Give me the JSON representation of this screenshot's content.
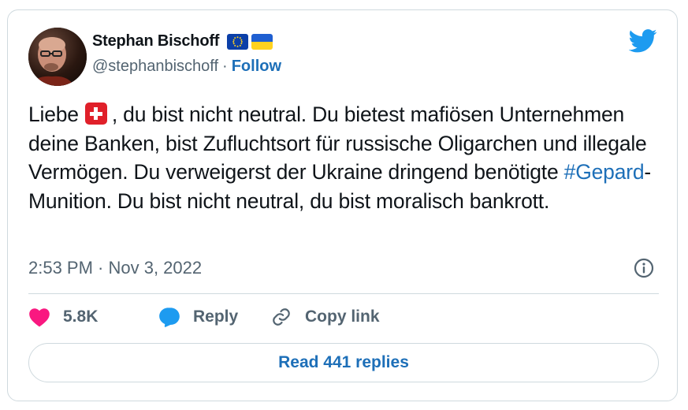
{
  "author": {
    "display_name": "Stephan Bischoff",
    "handle": "@stephanbischoff",
    "separator": "·",
    "follow_label": "Follow",
    "flags": [
      "eu-flag-icon",
      "ukraine-flag-icon"
    ]
  },
  "tweet": {
    "text_part1": "Liebe",
    "text_part2": ", du bist nicht neutral. Du bietest mafiösen Unternehmen deine Banken, bist Zufluchtsort für russische Oligarchen und illegale Vermögen. Du verweigerst der Ukraine dringend benötigte ",
    "hashtag": "#Gepard",
    "text_part3": "-Munition. Du bist nicht neutral, du bist moralisch bankrott.",
    "emoji": "swiss-flag-icon",
    "timestamp": "2:53 PM · Nov 3, 2022"
  },
  "actions": {
    "like_count": "5.8K",
    "reply_label": "Reply",
    "copy_link_label": "Copy link"
  },
  "read_replies_label": "Read 441 replies",
  "colors": {
    "accent": "#1d6fb8",
    "like": "#f91880",
    "reply": "#1d9bf0",
    "muted": "#536471",
    "border": "#cfd9de"
  },
  "icons": [
    "twitter-bird-icon",
    "info-icon",
    "heart-icon",
    "reply-bubble-icon",
    "link-icon"
  ]
}
